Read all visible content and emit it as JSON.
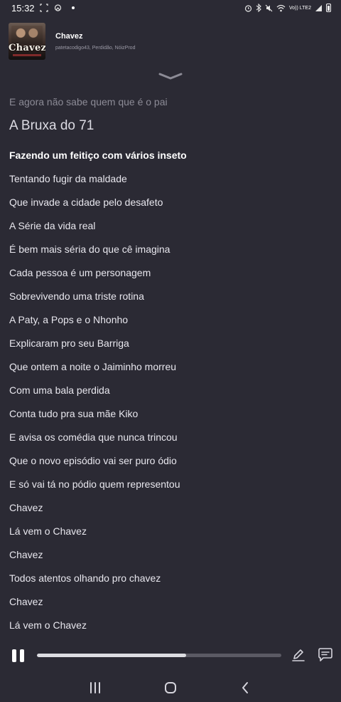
{
  "status_bar": {
    "time": "15:32",
    "icons_left": [
      "notification-bracket-icon",
      "cloud-icon",
      "dot-icon"
    ],
    "icons_right": [
      "alarm-icon",
      "bluetooth-icon",
      "mute-icon",
      "wifi-icon",
      "signal-icon",
      "battery-icon"
    ],
    "volte_label": "Vo)) LTE2"
  },
  "header": {
    "album_art_text": "Chavez",
    "track_title": "Chavez",
    "artists": "patetacodigo43, Perdidão, NóizProd"
  },
  "lyrics": {
    "previous_line": "E agora não sabe quem que é o pai",
    "current_line": "A Bruxa do 71",
    "next_line": "Fazendo um feitiço com vários inseto",
    "upcoming": [
      "Tentando fugir da maldade",
      "Que invade a cidade pelo desafeto",
      "A Série da vida real",
      "É bem mais séria do que cê imagina",
      "Cada pessoa é um personagem",
      "Sobrevivendo uma triste rotina",
      "A Paty, a Pops e o Nhonho",
      "Explicaram pro seu Barriga",
      "Que ontem a noite o Jaiminho morreu",
      "Com uma bala perdida",
      "Conta tudo pra sua mãe Kiko",
      "E avisa os comédia que nunca trincou",
      "Que o novo episódio vai ser puro ódio",
      "E só vai tá no pódio quem representou",
      "Chavez",
      "Lá vem o Chavez",
      "Chavez",
      "Todos atentos olhando pro chavez",
      "Chavez",
      "Lá vem o Chavez"
    ]
  },
  "player": {
    "progress": 0.61,
    "colors": {
      "background": "#2b2a34",
      "progress_fill": "#dddde2",
      "progress_track": "#5b5a64"
    }
  },
  "nav": {
    "buttons": [
      "recents-icon",
      "home-icon",
      "back-icon"
    ]
  }
}
